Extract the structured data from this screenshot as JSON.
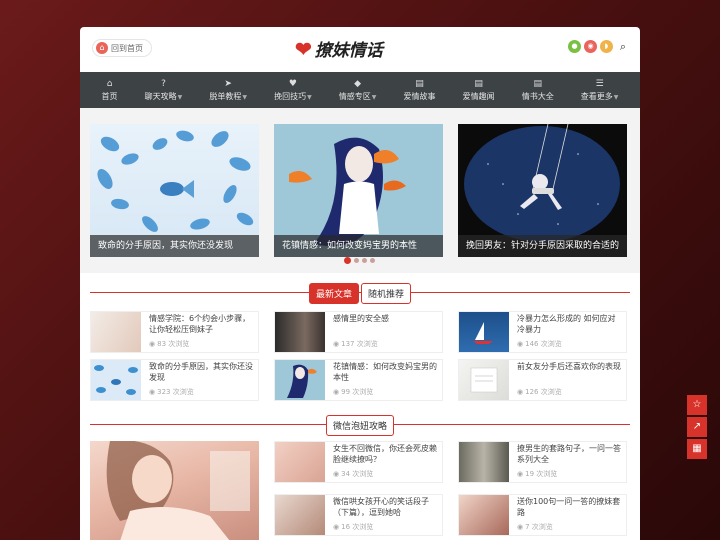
{
  "header": {
    "home_label": "回到首页",
    "logo_text": "撩妹情话",
    "icons": [
      "wechat-icon",
      "weibo-icon",
      "rss-icon",
      "search-icon"
    ]
  },
  "nav": [
    {
      "label": "首页",
      "icon": "home-icon",
      "dropdown": false
    },
    {
      "label": "聊天攻略",
      "icon": "question-icon",
      "dropdown": true
    },
    {
      "label": "脱单教程",
      "icon": "send-icon",
      "dropdown": true
    },
    {
      "label": "挽回技巧",
      "icon": "heart-icon",
      "dropdown": true
    },
    {
      "label": "情感专区",
      "icon": "tag-icon",
      "dropdown": true
    },
    {
      "label": "爱情故事",
      "icon": "document-icon",
      "dropdown": false
    },
    {
      "label": "爱情趣闻",
      "icon": "document-icon",
      "dropdown": false
    },
    {
      "label": "情书大全",
      "icon": "document-icon",
      "dropdown": false
    },
    {
      "label": "查看更多",
      "icon": "list-icon",
      "dropdown": true
    }
  ],
  "slider": {
    "slides": [
      {
        "caption": "致命的分手原因，其实你还没发现"
      },
      {
        "caption": "花镇情感：如何改变妈宝男的本性"
      },
      {
        "caption": "挽回男友：针对分手原因采取的合适的"
      }
    ],
    "active_dot": 0,
    "dot_count": 4
  },
  "latest": {
    "tabs": [
      "最新文章",
      "随机推荐"
    ],
    "items": [
      {
        "title": "情感学院：6个约会小步骤，让你轻松压倒妹子",
        "views": "83 次浏览"
      },
      {
        "title": "感情里的安全感",
        "views": "137 次浏览"
      },
      {
        "title": "冷暴力怎么形成的 如何应对冷暴力",
        "views": "146 次浏览"
      },
      {
        "title": "致命的分手原因，其实你还没发现",
        "views": "323 次浏览"
      },
      {
        "title": "花镇情感：如何改变妈宝男的本性",
        "views": "99 次浏览"
      },
      {
        "title": "前女友分手后还喜欢你的表现",
        "views": "126 次浏览"
      }
    ]
  },
  "wechat": {
    "tab": "微信泡妞攻略",
    "items": [
      {
        "title": "女生不回微信，你还会死皮赖脸继续撩吗？",
        "views": "34 次浏览"
      },
      {
        "title": "撩男生的套路句子，一问一答系列大全",
        "views": "19 次浏览"
      },
      {
        "title": "微信哄女孩开心的笑话段子（下篇），逗到她哈",
        "views": "16 次浏览"
      },
      {
        "title": "送你100句一问一答的撩妹套路",
        "views": "7 次浏览"
      }
    ]
  },
  "side_buttons": [
    "star-icon",
    "share-icon",
    "qrcode-icon"
  ]
}
